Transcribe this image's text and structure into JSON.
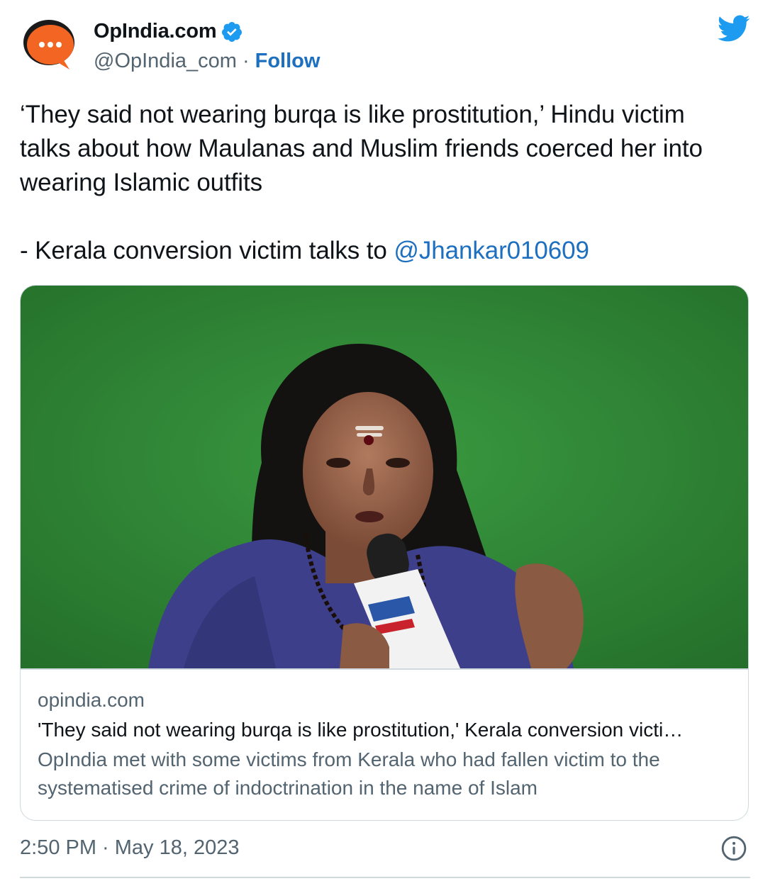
{
  "author": {
    "display_name": "OpIndia.com",
    "handle": "@OpIndia_com",
    "separator": "·",
    "follow_label": "Follow"
  },
  "tweet": {
    "text_line1": "‘They said not wearing burqa is like prostitution,’ Hindu victim talks about how Maulanas and Muslim friends coerced her into wearing Islamic outfits",
    "text_line2_prefix": "- Kerala conversion victim talks to ",
    "mention": "@Jhankar010609"
  },
  "card": {
    "domain": "opindia.com",
    "title": "'They said not wearing burqa is like prostitution,' Kerala conversion victi…",
    "description": "OpIndia met with some victims from Kerala who had fallen victim to the systematised crime of indoctrination in the name of Islam"
  },
  "footer": {
    "timestamp": "2:50 PM · May 18, 2023"
  },
  "colors": {
    "link": "#1d6fbf",
    "twitter_blue": "#1d9bf0",
    "text_primary": "#0f1419",
    "text_secondary": "#536471",
    "border": "#cfd9de",
    "avatar_orange": "#f26522",
    "green_screen": "#2e8a35"
  },
  "icons": {
    "verified": "verified-badge-icon",
    "brand": "twitter-bird-icon",
    "info": "info-icon"
  }
}
